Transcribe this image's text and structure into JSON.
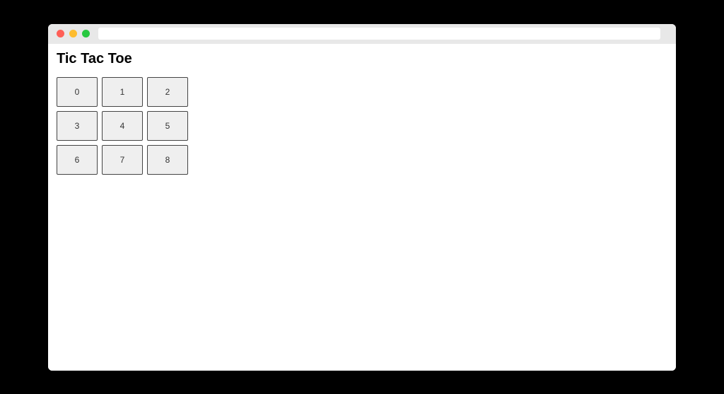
{
  "page": {
    "title": "Tic Tac Toe"
  },
  "board": {
    "cells": [
      "0",
      "1",
      "2",
      "3",
      "4",
      "5",
      "6",
      "7",
      "8"
    ]
  }
}
